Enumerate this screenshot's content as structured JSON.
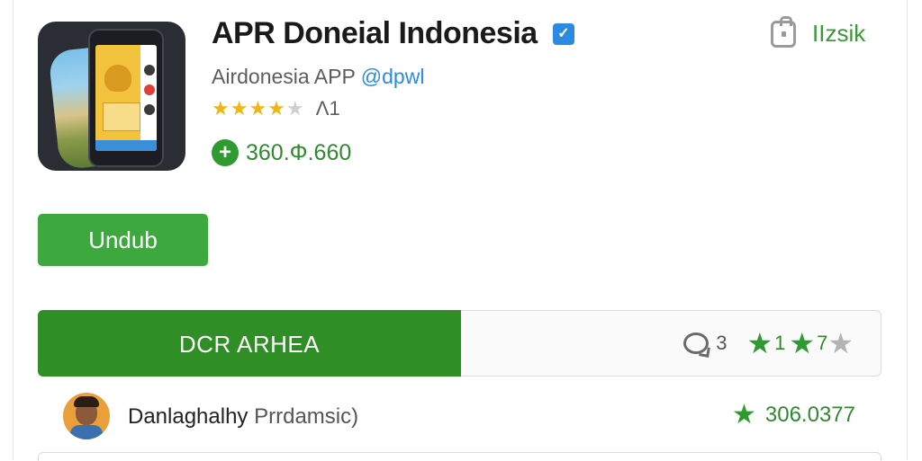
{
  "app": {
    "title": "APR Doneial Indonesia",
    "verified_icon": "check-badge-icon",
    "developer": "Airdonesia APP",
    "developer_handle": "@dpwl",
    "rating_stars": 4,
    "rating_max": 5,
    "rating_text": "Λ1",
    "downloads": "360.Φ.660",
    "download_icon": "plus-circle-icon"
  },
  "header_right": {
    "icon": "lock-icon",
    "label": "IIzsik"
  },
  "actions": {
    "download_label": "Undub"
  },
  "tabbar": {
    "active_tab": "DCR ARHEA",
    "comment_icon": "comment-icon",
    "comment_count": "3",
    "stat_a": "1",
    "stat_b": "7"
  },
  "review": {
    "name": "Danlaghalhy",
    "role": "Prrdamsic)",
    "score": "306.0377"
  },
  "colors": {
    "green_primary": "#3da83d",
    "green_dark": "#2f8f26",
    "star_gold": "#f2b614",
    "verified_blue": "#2a8be0",
    "icon_bg": "#2a2d33"
  }
}
